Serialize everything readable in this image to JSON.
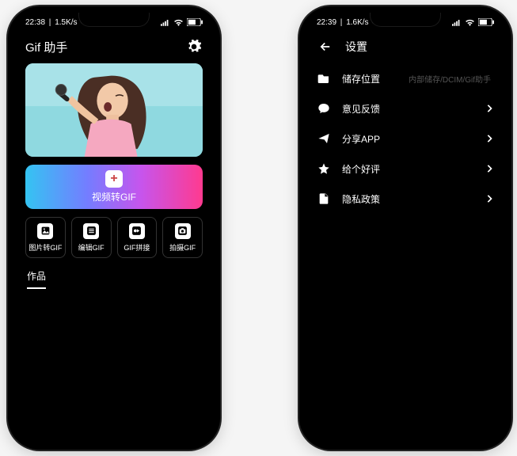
{
  "status": {
    "time_left": "22:38",
    "net_left": "1.5K/s",
    "time_right": "22:39",
    "net_right": "1.6K/s"
  },
  "home": {
    "title": "Gif 助手",
    "primary_label": "视频转GIF",
    "actions": [
      {
        "label": "图片转GIF"
      },
      {
        "label": "编辑GIF"
      },
      {
        "label": "GIF拼接"
      },
      {
        "label": "拍摄GIF"
      }
    ],
    "tab_works": "作品"
  },
  "settings": {
    "title": "设置",
    "rows": [
      {
        "label": "储存位置",
        "value": "内部储存/DCIM/Gif助手"
      },
      {
        "label": "意见反馈"
      },
      {
        "label": "分享APP"
      },
      {
        "label": "给个好评"
      },
      {
        "label": "隐私政策"
      }
    ]
  }
}
